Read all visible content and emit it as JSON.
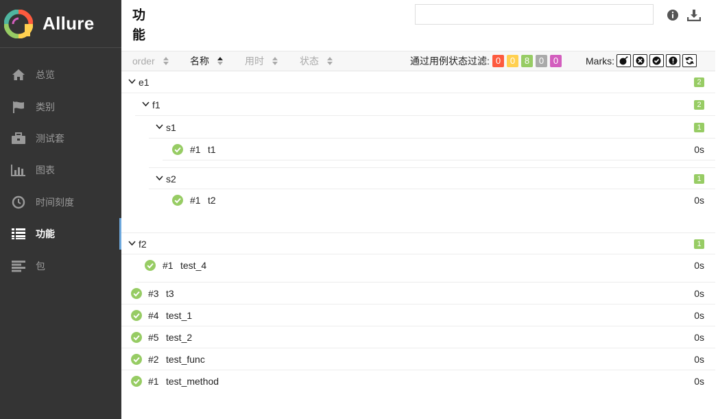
{
  "app": {
    "name": "Allure"
  },
  "sidebar": {
    "items": [
      {
        "label": "总览",
        "icon": "home-icon"
      },
      {
        "label": "类别",
        "icon": "flag-icon"
      },
      {
        "label": "测试套",
        "icon": "briefcase-icon"
      },
      {
        "label": "图表",
        "icon": "bar-chart-icon"
      },
      {
        "label": "时间刻度",
        "icon": "clock-icon"
      },
      {
        "label": "功能",
        "icon": "list-icon",
        "active": true
      },
      {
        "label": "包",
        "icon": "align-left-icon"
      }
    ]
  },
  "pane": {
    "title": "功能",
    "search": {
      "value": "",
      "placeholder": ""
    }
  },
  "toolbar": {
    "sorters": [
      {
        "label": "order",
        "active": false
      },
      {
        "label": "名称",
        "active": true
      },
      {
        "label": "用时",
        "active": false
      },
      {
        "label": "状态",
        "active": false
      }
    ],
    "filter_label": "通过用例状态过滤:",
    "status_counts": [
      {
        "status": "failed",
        "count": "0",
        "color": "#fd5a3e"
      },
      {
        "status": "broken",
        "count": "0",
        "color": "#ffd050"
      },
      {
        "status": "passed",
        "count": "8",
        "color": "#97cc64"
      },
      {
        "status": "skipped",
        "count": "0",
        "color": "#aaaaaa"
      },
      {
        "status": "unknown",
        "count": "0",
        "color": "#d35ebe"
      }
    ],
    "marks_label": "Marks:",
    "marks": [
      "bomb-icon",
      "close-circle-icon",
      "check-circle-icon",
      "exclamation-circle-icon",
      "refresh-icon"
    ]
  },
  "tree": {
    "e1": {
      "name": "e1",
      "count": "2"
    },
    "f1": {
      "name": "f1",
      "count": "2"
    },
    "s1": {
      "name": "s1",
      "count": "1"
    },
    "s1_t1": {
      "num": "#1",
      "name": "t1",
      "duration": "0s"
    },
    "s2": {
      "name": "s2",
      "count": "1"
    },
    "s2_t2": {
      "num": "#1",
      "name": "t2",
      "duration": "0s"
    },
    "f2": {
      "name": "f2",
      "count": "1"
    },
    "f2_test4": {
      "num": "#1",
      "name": "test_4",
      "duration": "0s"
    },
    "roots": [
      {
        "num": "#3",
        "name": "t3",
        "duration": "0s"
      },
      {
        "num": "#4",
        "name": "test_1",
        "duration": "0s"
      },
      {
        "num": "#5",
        "name": "test_2",
        "duration": "0s"
      },
      {
        "num": "#2",
        "name": "test_func",
        "duration": "0s"
      },
      {
        "num": "#1",
        "name": "test_method",
        "duration": "0s"
      }
    ]
  },
  "colors": {
    "sidebar_bg": "#343434",
    "accent": "#6ea8dc",
    "passed": "#97cc64"
  }
}
